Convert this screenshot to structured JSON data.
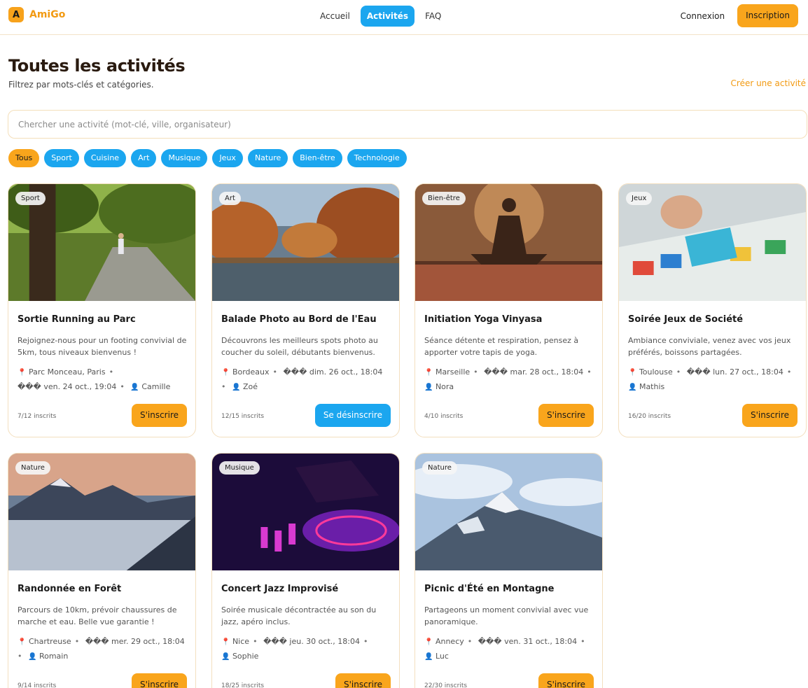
{
  "header": {
    "brand_letter": "A",
    "brand_name": "AmiGo",
    "nav": [
      "Accueil",
      "Activités",
      "FAQ"
    ],
    "login": "Connexion",
    "signup": "Inscription"
  },
  "page": {
    "title": "Toutes les activités",
    "subtitle": "Filtrez par mots-clés et catégories.",
    "create_link": "Créer une activité"
  },
  "search": {
    "placeholder": "Chercher une activité (mot-clé, ville, organisateur)",
    "value": ""
  },
  "filters": [
    "Tous",
    "Sport",
    "Cuisine",
    "Art",
    "Musique",
    "Jeux",
    "Nature",
    "Bien-être",
    "Technologie"
  ],
  "colors": {
    "accent_orange": "#f9a51c",
    "accent_blue": "#1ba6ef",
    "brand_text": "#f29a12"
  },
  "cards": [
    {
      "category": "Sport",
      "title": "Sortie Running au Parc",
      "desc": "Rejoignez-nous pour un footing convivial de 5km, tous niveaux bienvenus !",
      "city": "Parc Monceau, Paris",
      "date": "��� ven. 24 oct., 19:04",
      "organizer": "Camille",
      "count": "7/12 inscrits",
      "action": "S'inscrire"
    },
    {
      "category": "Art",
      "title": "Balade Photo au Bord de l'Eau",
      "desc": "Découvrons les meilleurs spots photo au coucher du soleil, débutants bienvenus.",
      "city": "Bordeaux",
      "date": "��� dim. 26 oct., 18:04",
      "organizer": "Zoé",
      "count": "12/15 inscrits",
      "action": "Se désinscrire"
    },
    {
      "category": "Bien-être",
      "title": "Initiation Yoga Vinyasa",
      "desc": "Séance détente et respiration, pensez à apporter votre tapis de yoga.",
      "city": "Marseille",
      "date": "��� mar. 28 oct., 18:04",
      "organizer": "Nora",
      "count": "4/10 inscrits",
      "action": "S'inscrire"
    },
    {
      "category": "Jeux",
      "title": "Soirée Jeux de Société",
      "desc": "Ambiance conviviale, venez avec vos jeux préférés, boissons partagées.",
      "city": "Toulouse",
      "date": "��� lun. 27 oct., 18:04",
      "organizer": "Mathis",
      "count": "16/20 inscrits",
      "action": "S'inscrire"
    },
    {
      "category": "Nature",
      "title": "Randonnée en Forêt",
      "desc": "Parcours de 10km, prévoir chaussures de marche et eau. Belle vue garantie !",
      "city": "Chartreuse",
      "date": "��� mer. 29 oct., 18:04",
      "organizer": "Romain",
      "count": "9/14 inscrits",
      "action": "S'inscrire"
    },
    {
      "category": "Musique",
      "title": "Concert Jazz Improvisé",
      "desc": "Soirée musicale décontractée au son du jazz, apéro inclus.",
      "city": "Nice",
      "date": "��� jeu. 30 oct., 18:04",
      "organizer": "Sophie",
      "count": "18/25 inscrits",
      "action": "S'inscrire"
    },
    {
      "category": "Nature",
      "title": "Picnic d'Été en Montagne",
      "desc": "Partageons un moment convivial avec vue panoramique.",
      "city": "Annecy",
      "date": "��� ven. 31 oct., 18:04",
      "organizer": "Luc",
      "count": "22/30 inscrits",
      "action": "S'inscrire"
    }
  ]
}
